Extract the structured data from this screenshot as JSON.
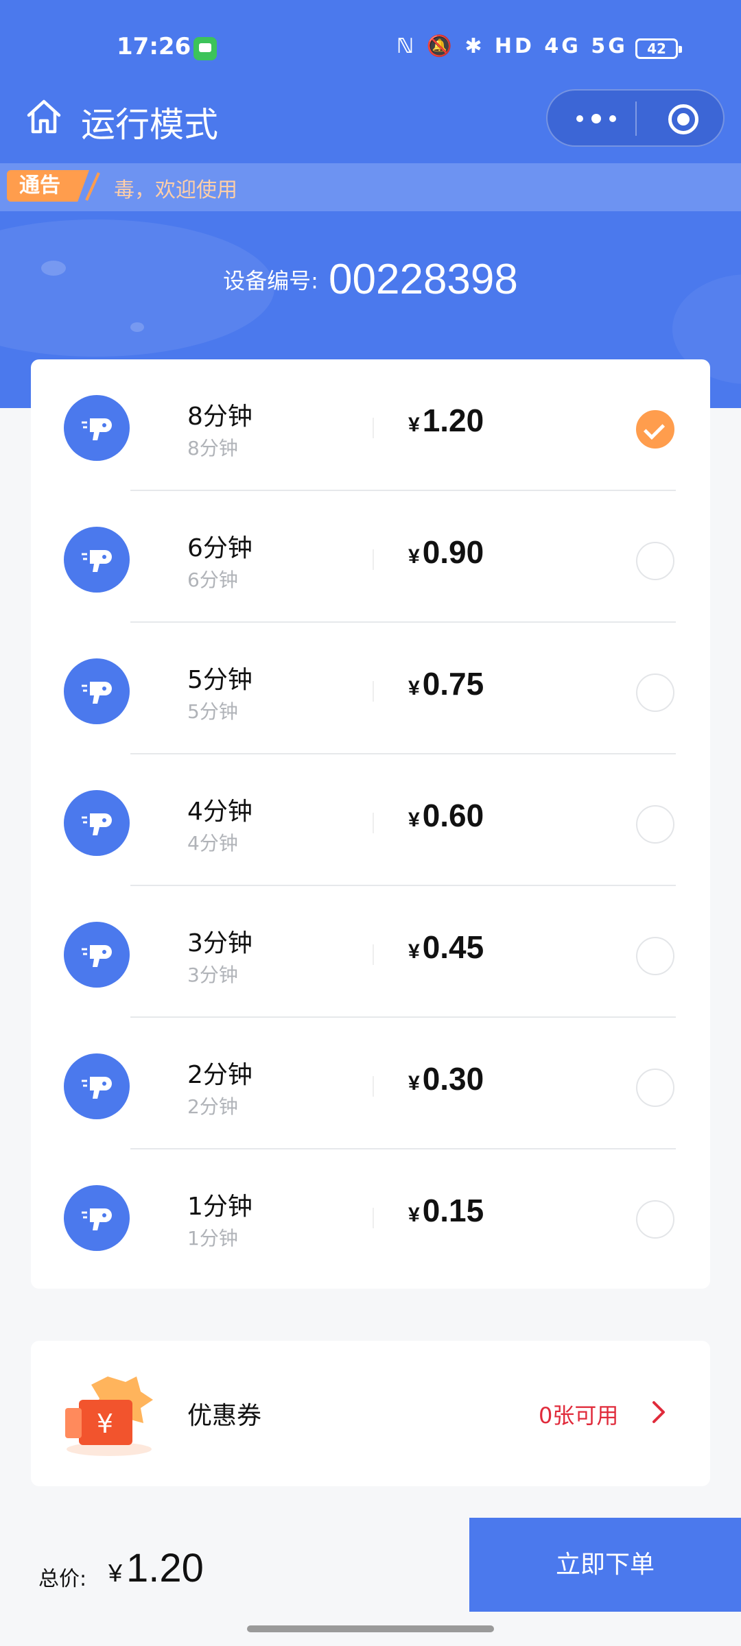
{
  "status_bar": {
    "time": "17:26",
    "icons_text": "ℕ 🔕 ✱ HD 4G 5G",
    "battery": "42"
  },
  "nav": {
    "title": "运行模式",
    "home_icon": "home-icon",
    "more_icon": "more-dots-icon",
    "close_icon": "target-circle-icon"
  },
  "notice": {
    "tag": "通告",
    "text": "毒，欢迎使用"
  },
  "device": {
    "label": "设备编号:",
    "number": "00228398"
  },
  "options": [
    {
      "name": "8分钟",
      "sub": "8分钟",
      "yen": "¥",
      "price": "1.20",
      "selected": true
    },
    {
      "name": "6分钟",
      "sub": "6分钟",
      "yen": "¥",
      "price": "0.90",
      "selected": false
    },
    {
      "name": "5分钟",
      "sub": "5分钟",
      "yen": "¥",
      "price": "0.75",
      "selected": false
    },
    {
      "name": "4分钟",
      "sub": "4分钟",
      "yen": "¥",
      "price": "0.60",
      "selected": false
    },
    {
      "name": "3分钟",
      "sub": "3分钟",
      "yen": "¥",
      "price": "0.45",
      "selected": false
    },
    {
      "name": "2分钟",
      "sub": "2分钟",
      "yen": "¥",
      "price": "0.30",
      "selected": false
    },
    {
      "name": "1分钟",
      "sub": "1分钟",
      "yen": "¥",
      "price": "0.15",
      "selected": false
    }
  ],
  "coupon": {
    "label": "优惠券",
    "available": "0张可用",
    "coupon_symbol": "¥"
  },
  "footer": {
    "total_label": "总价:",
    "yen": "¥",
    "total": "1.20",
    "order_button": "立即下单"
  },
  "colors": {
    "primary": "#4b79ed",
    "accent": "#ff9d4d",
    "danger": "#e02b3b"
  }
}
